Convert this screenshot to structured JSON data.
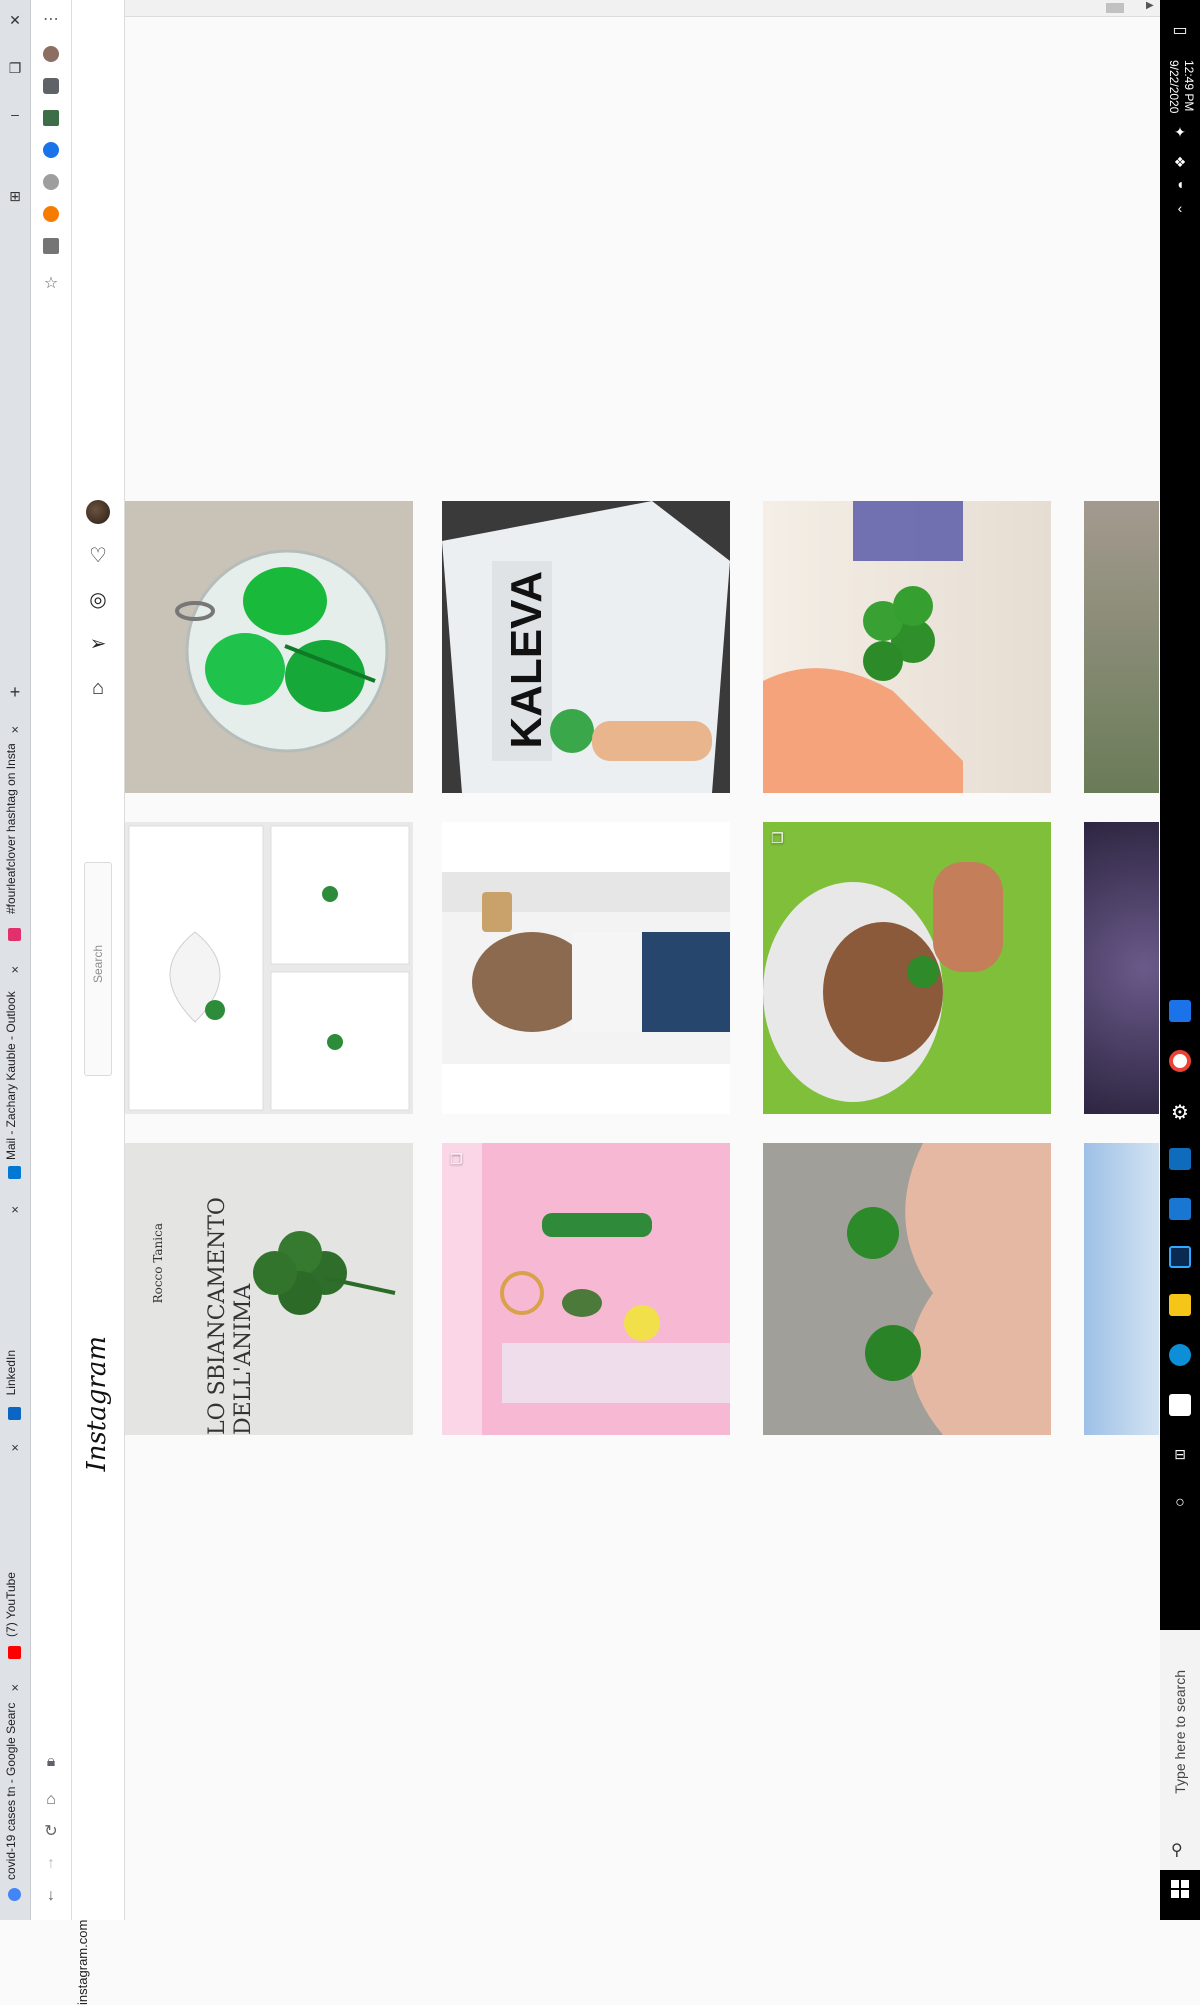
{
  "browser": {
    "tabs": [
      {
        "label": "#fourleafclover hashtag on Insta",
        "icon_color": "#e1306c",
        "active": true
      },
      {
        "label": "Mail - Zachary Kauble - Outlook",
        "icon_color": "#0078d4"
      },
      {
        "label": "LinkedIn",
        "icon_color": "#0a66c2"
      },
      {
        "label": "(7) YouTube",
        "icon_color": "#ff0000"
      },
      {
        "label": "covid-19 cases tn - Google Searc",
        "icon_color": "#4285f4"
      }
    ],
    "new_tab": "+",
    "close": "×",
    "url": "instagram.com/explore/tags/fourleafclover/"
  },
  "instagram": {
    "logo": "Instagram",
    "search_placeholder": "Search",
    "nav_icons": [
      "home-icon",
      "send-icon",
      "explore-icon",
      "activity-heart-icon",
      "profile-avatar"
    ]
  },
  "grid": {
    "rows": [
      [
        {
          "caption": "",
          "kind": "resin-clover"
        },
        {
          "caption": "KALEVA",
          "kind": "newspaper"
        },
        {
          "caption": "",
          "kind": "hand-clover"
        },
        {
          "caption": "",
          "kind": "partial-person"
        }
      ],
      [
        {
          "caption": "",
          "kind": "framed-hearts"
        },
        {
          "caption": "",
          "kind": "selfie"
        },
        {
          "caption": "",
          "kind": "child-clover",
          "multi": true
        },
        {
          "caption": "",
          "kind": "partial-purple"
        }
      ],
      [
        {
          "caption": "LO SBIANCAMENTO DELL'ANIMA",
          "subcaption": "Rocco Tanica",
          "kind": "book-clover"
        },
        {
          "caption": "",
          "kind": "keychain",
          "multi": true
        },
        {
          "caption": "",
          "kind": "two-clovers"
        },
        {
          "caption": "",
          "kind": "partial-sky"
        }
      ]
    ]
  },
  "taskbar": {
    "time": "12:49 PM",
    "date": "9/22/2020",
    "search_placeholder": "Type here to search"
  }
}
